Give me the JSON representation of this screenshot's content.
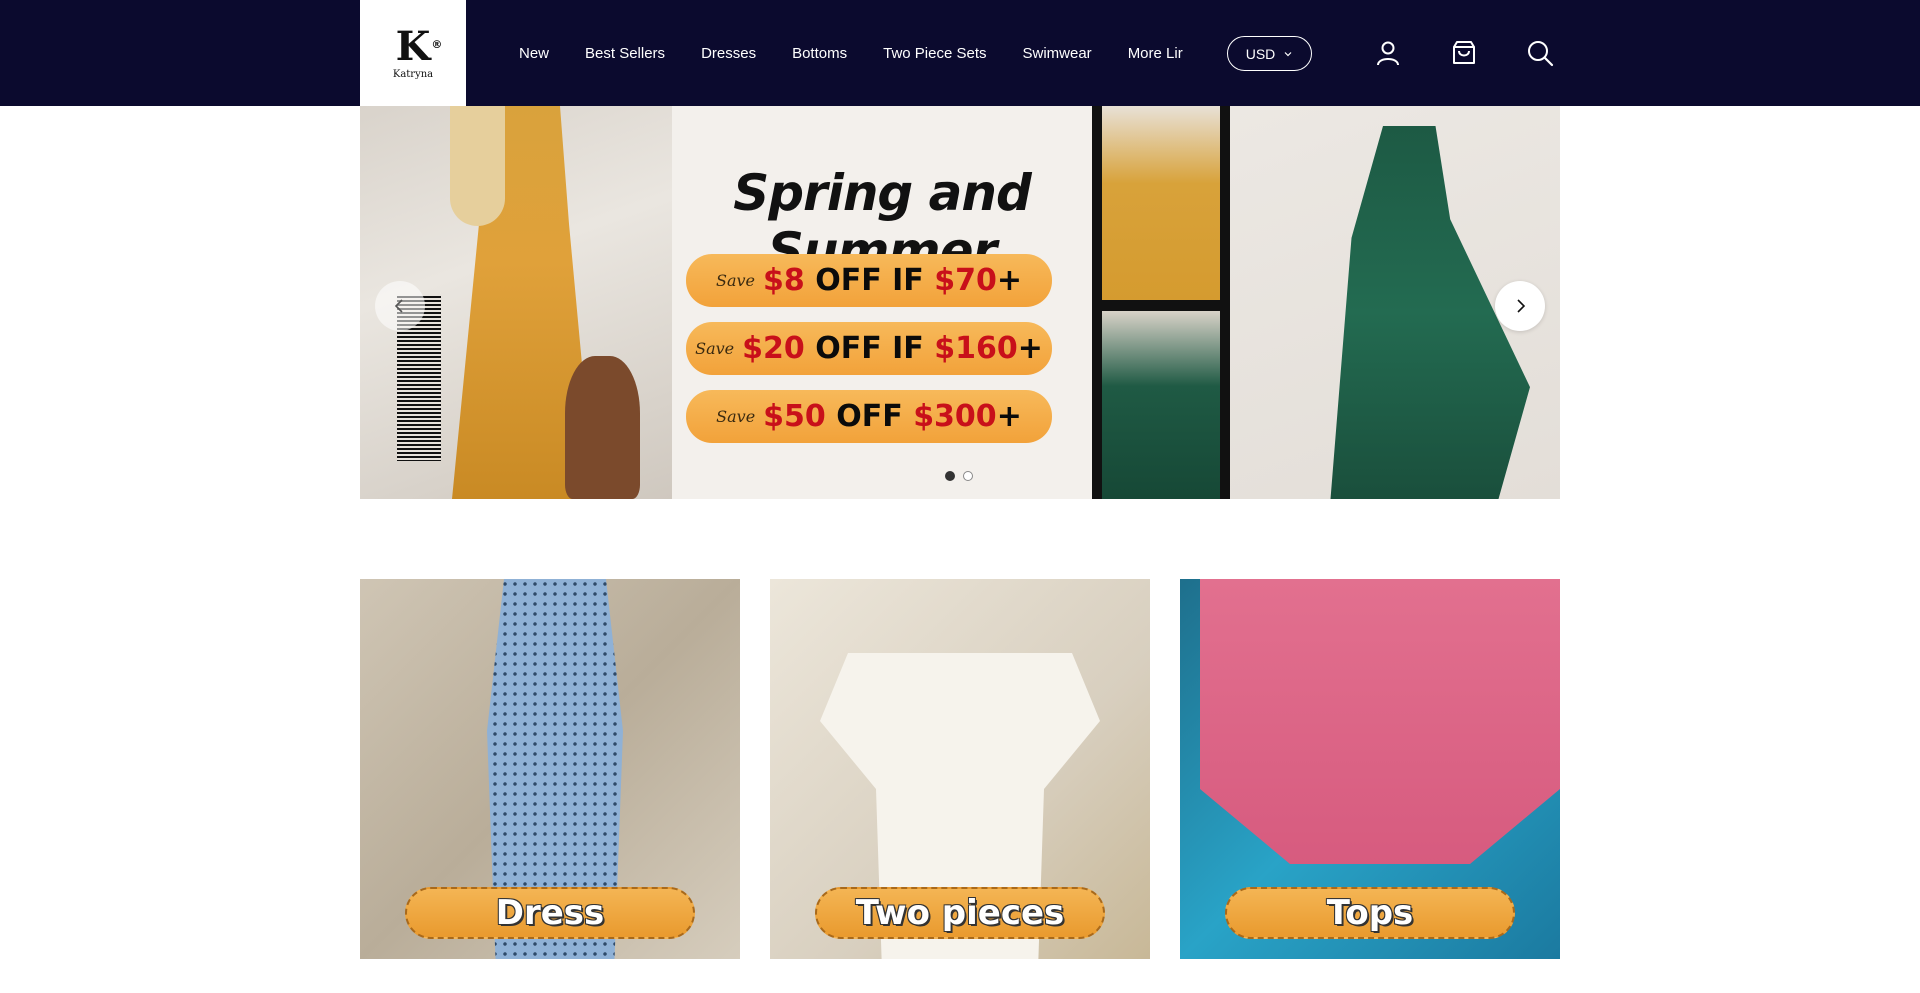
{
  "brand": {
    "logo_letter": "K",
    "logo_mark": "®",
    "name": "Katryna"
  },
  "nav": {
    "items": [
      {
        "label": "New"
      },
      {
        "label": "Best Sellers"
      },
      {
        "label": "Dresses"
      },
      {
        "label": "Bottoms"
      },
      {
        "label": "Two Piece Sets"
      },
      {
        "label": "Swimwear"
      },
      {
        "label": "More Lir"
      }
    ]
  },
  "currency": {
    "selected": "USD"
  },
  "header_icons": [
    "account-icon",
    "cart-icon",
    "search-icon"
  ],
  "hero": {
    "title": "Spring and Summer",
    "promos": [
      {
        "save": "Save",
        "amount": "$8",
        "mid": " OFF IF ",
        "threshold": "$70",
        "suffix": "+"
      },
      {
        "save": "Save",
        "amount": "$20",
        "mid": " OFF IF ",
        "threshold": "$160",
        "suffix": "+"
      },
      {
        "save": "Save",
        "amount": "$50",
        "mid": " OFF ",
        "threshold": "$300",
        "suffix": "+"
      }
    ],
    "slide_count": 2,
    "active_slide": 1
  },
  "categories": [
    {
      "label": "Dress"
    },
    {
      "label": "Two pieces"
    },
    {
      "label": "Tops"
    }
  ],
  "colors": {
    "header_bg": "#0b0a2e",
    "promo_orange": "#f2a23a",
    "promo_red": "#c8101a"
  }
}
